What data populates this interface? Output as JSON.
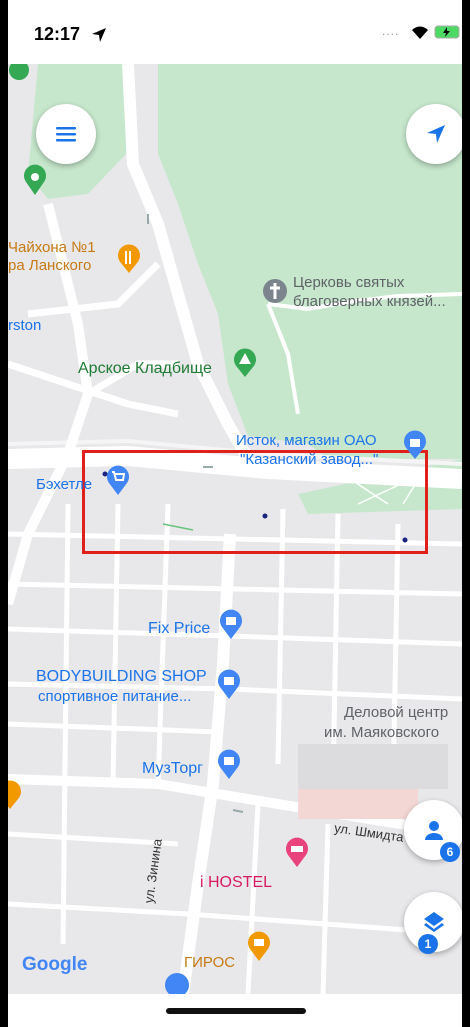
{
  "status_bar": {
    "time": "12:17",
    "signal": "....",
    "location_arrow_icon": "location-arrow"
  },
  "map": {
    "labels": {
      "chaikhona": "Чайхона №1",
      "lanskogo": "ра Ланского",
      "rston": "rston",
      "church_line1": "Церковь святых",
      "church_line2": "благоверных князей...",
      "cemetery": "Арское Кладбище",
      "istok_line1": "Исток, магазин ОАО",
      "istok_line2": "\"Казанский завод...\"",
      "bekhetle": "Бэхетле",
      "fixprice": "Fix Price",
      "bodybuilding_line1": "BODYBUILDING SHOP",
      "bodybuilding_line2": "спортивное питание...",
      "delovoy_line1": "Деловой центр",
      "delovoy_line2": "им. Маяковского",
      "muztorg": "МузТорг",
      "schmidt": "ул. Шмидта",
      "ihostel": "i HOSTEL",
      "zinina": "ул. Зинина",
      "giros": "ГИРОС",
      "google": "Google"
    },
    "colors": {
      "park": "#c6e7cc",
      "road": "#ffffff",
      "base": "#e8e8eb",
      "highlight": "#e0201a",
      "accent": "#1a73e8"
    }
  },
  "controls": {
    "people_badge": "6",
    "layers_badge": "1"
  }
}
